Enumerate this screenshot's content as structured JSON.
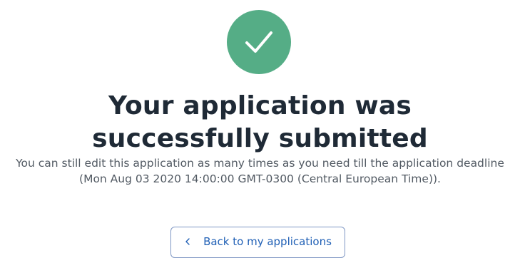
{
  "success": {
    "icon": "checkmark-icon",
    "badge_color": "#55ad86",
    "check_color": "#ffffff"
  },
  "title": "Your application was successfully submitted",
  "message": "You can still edit this application as many times as you need till the application deadline (Mon Aug 03 2020 14:00:00 GMT-0300  (Central European Time)).",
  "back_button": {
    "label": "Back to my applications",
    "icon": "chevron-left-icon",
    "text_color": "#1f5fb5",
    "border_color": "#7f97c4"
  }
}
